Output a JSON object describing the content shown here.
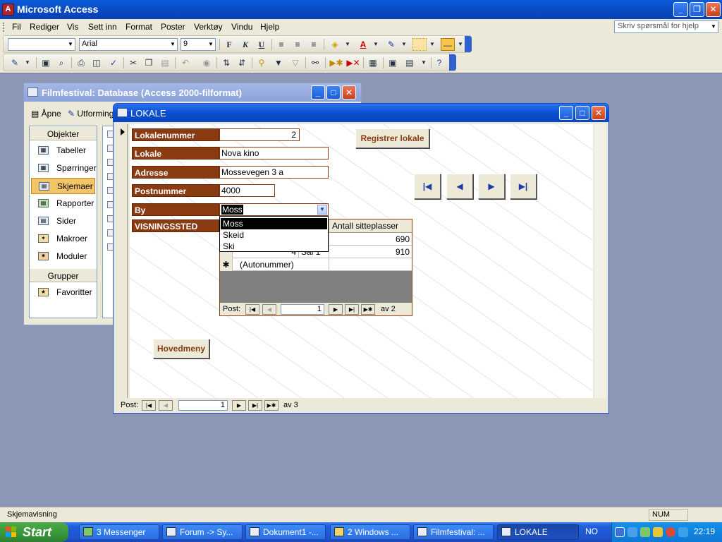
{
  "app": {
    "title": "Microsoft Access",
    "window_buttons": {
      "minimize": "_",
      "restore": "❐",
      "close": "✕"
    }
  },
  "menu": {
    "items": [
      "Fil",
      "Rediger",
      "Vis",
      "Sett inn",
      "Format",
      "Poster",
      "Verktøy",
      "Vindu",
      "Hjelp"
    ],
    "help_placeholder": "Skriv spørsmål for hjelp"
  },
  "format_toolbar": {
    "font": "Arial",
    "size": "9"
  },
  "db_window": {
    "title": "Filmfestival: Database (Access 2000-filformat)",
    "toolbar": {
      "open": "Åpne",
      "design": "Utforming"
    },
    "objects_header": "Objekter",
    "objects": [
      "Tabeller",
      "Spørringer",
      "Skjemaer",
      "Rapporter",
      "Sider",
      "Makroer",
      "Moduler"
    ],
    "groups_header": "Grupper",
    "groups": [
      "Favoritter"
    ]
  },
  "form": {
    "title": "LOKALE",
    "labels": {
      "lokalenummer": "Lokalenummer",
      "lokale": "Lokale",
      "adresse": "Adresse",
      "postnummer": "Postnummer",
      "by": "By",
      "visningssted": "VISNINGSSTED"
    },
    "values": {
      "lokalenummer": "2",
      "lokale": "Nova kino",
      "adresse": "Mossevegen 3 a",
      "postnummer": "4000",
      "by": "Moss"
    },
    "register_button": "Registrer lokale",
    "main_menu_button": "Hovedmeny",
    "city_options": [
      "Moss",
      "Skeid",
      "Ski"
    ],
    "subform": {
      "column_header": "Antall sitteplasser",
      "rows": [
        {
          "id": "",
          "name": "",
          "seats": "690"
        },
        {
          "id": "4",
          "name": "Sal 1",
          "seats": "910"
        }
      ],
      "new_row": "(Autonummer)",
      "nav": {
        "label": "Post:",
        "current": "1",
        "of": "av 2"
      }
    },
    "nav": {
      "label": "Post:",
      "current": "1",
      "of": "av 3"
    }
  },
  "status": {
    "text": "Skjemavisning",
    "num": "NUM"
  },
  "taskbar": {
    "start": "Start",
    "tasks": [
      "3 Messenger",
      "Forum -> Sy...",
      "Dokument1 -...",
      "2 Windows ...",
      "Filmfestival: ...",
      "LOKALE"
    ],
    "lang": "NO",
    "clock": "22:19"
  }
}
